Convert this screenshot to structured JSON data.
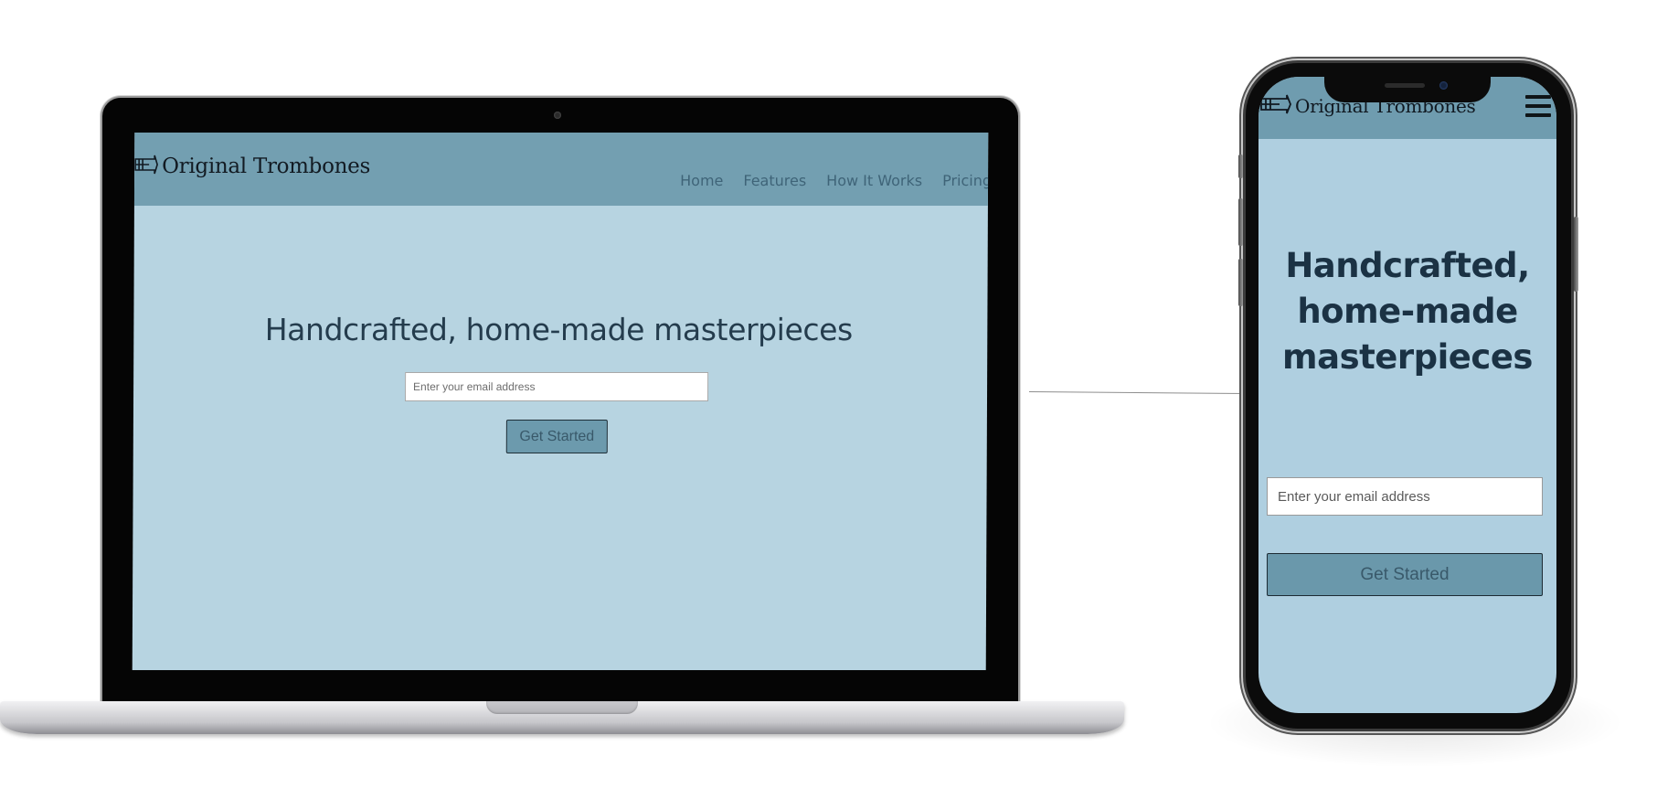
{
  "brand": {
    "name": "Original Trombones",
    "logo_icon": "trombone-icon"
  },
  "desktop": {
    "nav": [
      {
        "label": "Home"
      },
      {
        "label": "Features"
      },
      {
        "label": "How It Works"
      },
      {
        "label": "Pricing"
      }
    ],
    "hero_title": "Handcrafted, home-made masterpieces",
    "email_placeholder": "Enter your email address",
    "cta_label": "Get Started"
  },
  "mobile": {
    "menu_icon": "hamburger-menu-icon",
    "hero_title": "Handcrafted, home-made masterpieces",
    "email_placeholder": "Enter your email address",
    "cta_label": "Get Started"
  },
  "colors": {
    "header_bg": "#739fb1",
    "page_bg": "#b7d4e1",
    "heading": "#243c4d",
    "button_bg": "#6c9aad"
  }
}
